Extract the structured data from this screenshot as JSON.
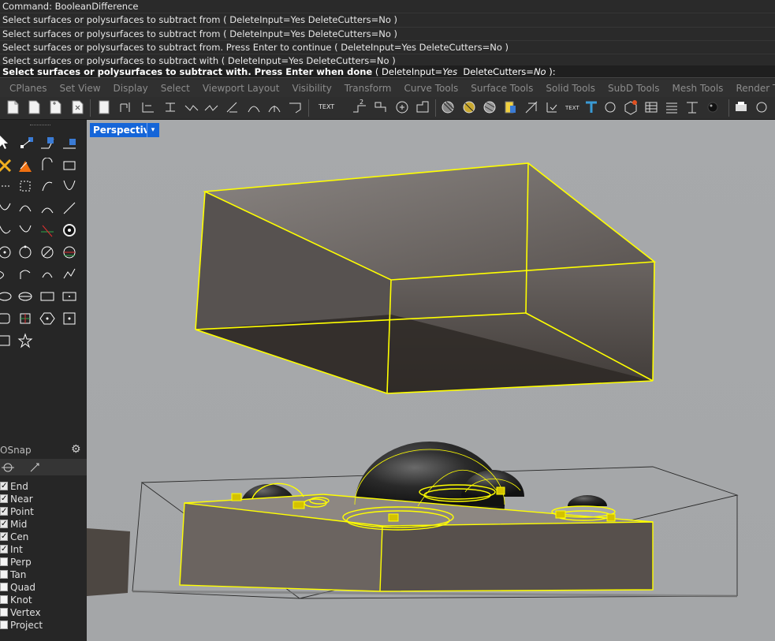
{
  "history": [
    "Command: BooleanDifference",
    "Select surfaces or polysurfaces to subtract from ( DeleteInput=Yes  DeleteCutters=No )",
    "Select surfaces or polysurfaces to subtract from ( DeleteInput=Yes  DeleteCutters=No )",
    "Select surfaces or polysurfaces to subtract from. Press Enter to continue ( DeleteInput=Yes  DeleteCutters=No )",
    "Select surfaces or polysurfaces to subtract with ( DeleteInput=Yes  DeleteCutters=No )"
  ],
  "prompt": {
    "main": "Select surfaces or polysurfaces to subtract with. Press Enter when done",
    "open": " ( ",
    "opt1_name": "DeleteInput=",
    "opt1_value": "Yes",
    "opt2_name": "DeleteCutters=",
    "opt2_value": "No",
    "close": " ):"
  },
  "tabs": [
    "CPlanes",
    "Set View",
    "Display",
    "Select",
    "Viewport Layout",
    "Visibility",
    "Transform",
    "Curve Tools",
    "Surface Tools",
    "Solid Tools",
    "SubD Tools",
    "Mesh Tools",
    "Render Tools"
  ],
  "toolbar_text": {
    "text_tool": "TEXT",
    "dim_tool": "2"
  },
  "viewport": {
    "label": "Perspective",
    "dropdown": "▾"
  },
  "osnap": {
    "title": "OSnap",
    "items": [
      {
        "label": "End",
        "checked": true
      },
      {
        "label": "Near",
        "checked": true
      },
      {
        "label": "Point",
        "checked": true
      },
      {
        "label": "Mid",
        "checked": true
      },
      {
        "label": "Cen",
        "checked": true
      },
      {
        "label": "Int",
        "checked": true
      },
      {
        "label": "Perp",
        "checked": false
      },
      {
        "label": "Tan",
        "checked": false
      },
      {
        "label": "Quad",
        "checked": false
      },
      {
        "label": "Knot",
        "checked": false
      },
      {
        "label": "Vertex",
        "checked": false
      },
      {
        "label": "Project",
        "checked": false
      }
    ]
  },
  "colors": {
    "selection": "#ffff00",
    "viewport_tab": "#1565d8",
    "viewport_bg": "#a6a8aa"
  }
}
